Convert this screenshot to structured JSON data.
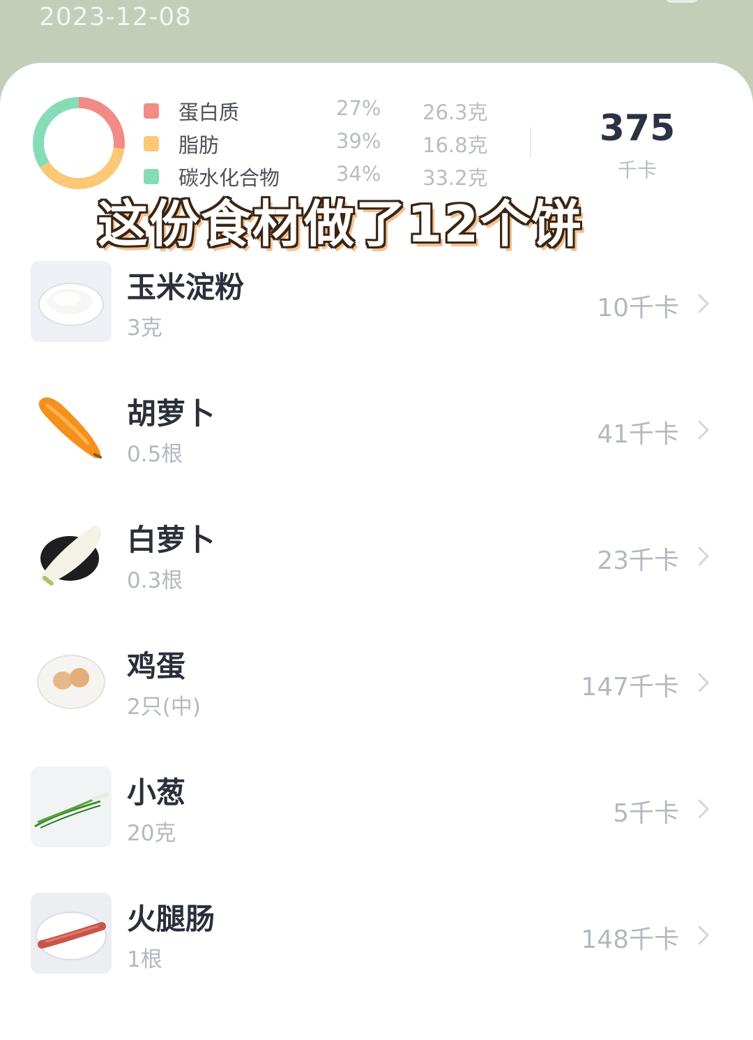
{
  "header": {
    "date": "2023-12-08"
  },
  "summary": {
    "macros": [
      {
        "name": "蛋白质",
        "percent": "27%",
        "grams": "26.3克",
        "color": "#f28b86",
        "share": 0.27
      },
      {
        "name": "脂肪",
        "percent": "39%",
        "grams": "16.8克",
        "color": "#fbc876",
        "share": 0.39
      },
      {
        "name": "碳水化合物",
        "percent": "34%",
        "grams": "33.2克",
        "color": "#86dcb6",
        "share": 0.34
      }
    ],
    "total_calories": "375",
    "total_unit": "千卡"
  },
  "overlay_caption": "这份食材做了12个饼",
  "foods": [
    {
      "name": "玉米淀粉",
      "amount": "3克",
      "calories": "10千卡",
      "icon": "cornstarch-image"
    },
    {
      "name": "胡萝卜",
      "amount": "0.5根",
      "calories": "41千卡",
      "icon": "carrot-image"
    },
    {
      "name": "白萝卜",
      "amount": "0.3根",
      "calories": "23千卡",
      "icon": "white-radish-image"
    },
    {
      "name": "鸡蛋",
      "amount": "2只(中)",
      "calories": "147千卡",
      "icon": "eggs-image"
    },
    {
      "name": "小葱",
      "amount": "20克",
      "calories": "5千卡",
      "icon": "scallion-image"
    },
    {
      "name": "火腿肠",
      "amount": "1根",
      "calories": "148千卡",
      "icon": "ham-sausage-image"
    }
  ]
}
